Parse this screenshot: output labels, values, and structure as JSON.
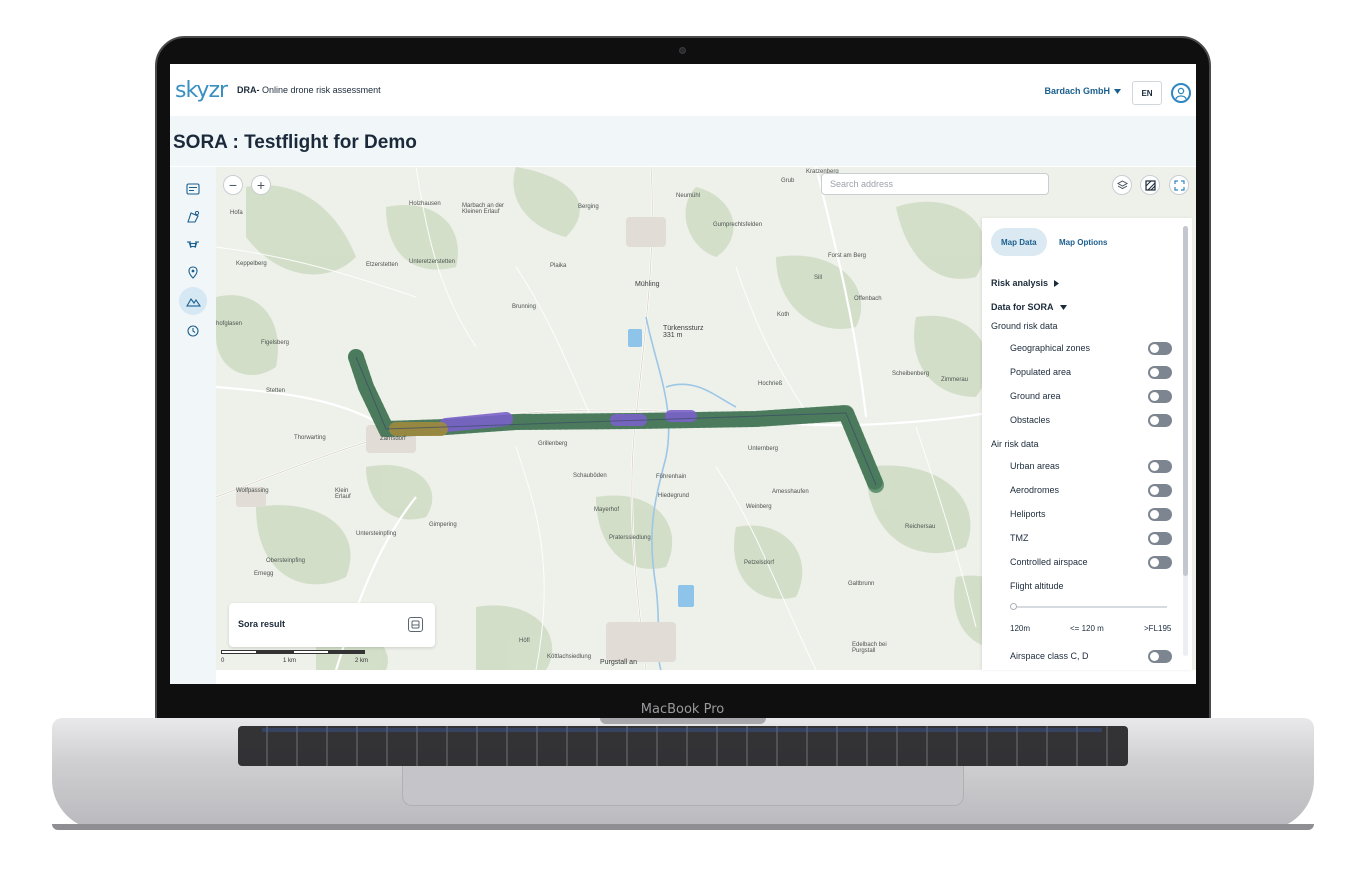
{
  "device": {
    "model_label": "MacBook Pro"
  },
  "header": {
    "logo": "skyzr",
    "subtitle_bold": "DRA-",
    "subtitle": " Online drone risk assessment",
    "org": "Bardach GmbH",
    "lang": "EN"
  },
  "page": {
    "title": "SORA : Testflight for Demo"
  },
  "sidebar": {
    "items": [
      {
        "icon": "layers-list-icon"
      },
      {
        "icon": "drone-area-icon"
      },
      {
        "icon": "drone-icon"
      },
      {
        "icon": "location-pin-icon"
      },
      {
        "icon": "terrain-icon",
        "active": true
      },
      {
        "icon": "history-icon"
      }
    ]
  },
  "map": {
    "search": {
      "placeholder": "Search address",
      "value": ""
    },
    "zoom_out": "−",
    "zoom_in": "+",
    "labels": [
      "Kratzenberg",
      "Grub",
      "Holzhausen",
      "Marbach an der Kleinen Erlauf",
      "Berging",
      "Neumühl",
      "Hofa",
      "Gumprechtsfelden",
      "Keppelberg",
      "Etzerstetten",
      "Unteretzerstetten",
      "Plaika",
      "Mühling",
      "Forst am Berg",
      "Sill",
      "Brunning",
      "Offenbach",
      "hofglasen",
      "Figelsberg",
      "Türkenssturz 331 m",
      "Koth",
      "Scheibenberg",
      "Zimmerau",
      "Hochrieß",
      "Stetten",
      "Thorwarting",
      "Zarnsdorf",
      "Unternberg",
      "Grillenberg",
      "Schauböden",
      "Föhrenhain",
      "Hiedegrund",
      "Amesshaufen",
      "Wolfpassing",
      "Klein Erlauf",
      "Weinberg",
      "Mayerhof",
      "Reichersau",
      "Gimpering",
      "Untersteinpfing",
      "Praterssiedlung",
      "Obersteinpfing",
      "Ernegg",
      "Petzelsdorf",
      "Galtbrunn",
      "Höfl",
      "Köttlachsiedlung",
      "Purgstall an",
      "Edelbach bei Purgstall"
    ],
    "scale": {
      "zero": "0",
      "mid": "1 km",
      "max": "2 km"
    }
  },
  "sora_result": {
    "label": "Sora result"
  },
  "panel": {
    "tabs": [
      "Map Data",
      "Map Options"
    ],
    "risk_analysis": "Risk analysis",
    "data_for_sora": "Data for SORA",
    "ground_risk": {
      "label": "Ground risk data",
      "items": [
        "Geographical zones",
        "Populated area",
        "Ground area",
        "Obstacles"
      ]
    },
    "air_risk": {
      "label": "Air risk data",
      "items": [
        "Urban areas",
        "Aerodromes",
        "Heliports",
        "TMZ",
        "Controlled airspace"
      ]
    },
    "flight_altitude": {
      "label": "Flight altitude",
      "value": 0,
      "min_label": "120m",
      "mid_label": "<= 120 m",
      "max_label": ">FL195"
    },
    "airspace_cd": "Airspace class C, D"
  },
  "colors": {
    "accent": "#1b5f8e",
    "hex_green": "#5d8f6e",
    "hex_purple": "#7a62c9",
    "hex_olive": "#a08a3e"
  }
}
